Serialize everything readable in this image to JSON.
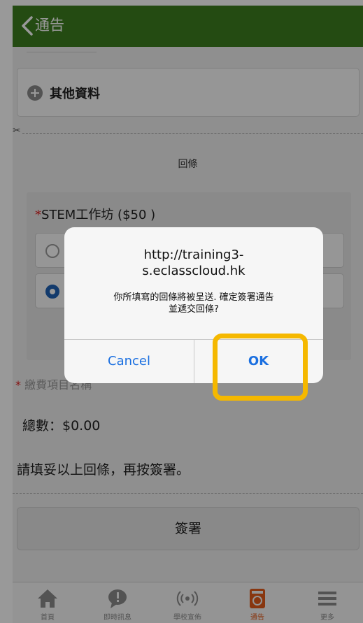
{
  "nav": {
    "title": "通告"
  },
  "main": {
    "other_info_label": "其他資料",
    "reply_heading": "回條",
    "question": {
      "required_mark": "*",
      "label": "STEM工作坊 ($50 )"
    },
    "payment_item": {
      "required_mark": "* ",
      "label": "繳費項目名稱"
    },
    "total": "總數：$0.00",
    "notice": "請填妥以上回條，再按簽署。",
    "sign_button": "簽署"
  },
  "tabs": [
    {
      "label": "首頁",
      "icon": "home-icon"
    },
    {
      "label": "即時訊息",
      "icon": "chat-icon"
    },
    {
      "label": "學校宣佈",
      "icon": "broadcast-icon"
    },
    {
      "label": "通告",
      "icon": "notice-icon",
      "active": true
    },
    {
      "label": "更多",
      "icon": "menu-icon"
    }
  ],
  "alert": {
    "title_line1": "http://training3-",
    "title_line2": "s.eclasscloud.hk",
    "message_line1": "你所填寫的回條將被呈送. 確定簽署通告",
    "message_line2": "並遞交回條?",
    "cancel_label": "Cancel",
    "ok_label": "OK"
  },
  "colors": {
    "nav_bar": "#3d7d1f",
    "alert_button": "#1a6fe0",
    "highlight": "#f5b800",
    "active_tab": "#e35a1a"
  }
}
